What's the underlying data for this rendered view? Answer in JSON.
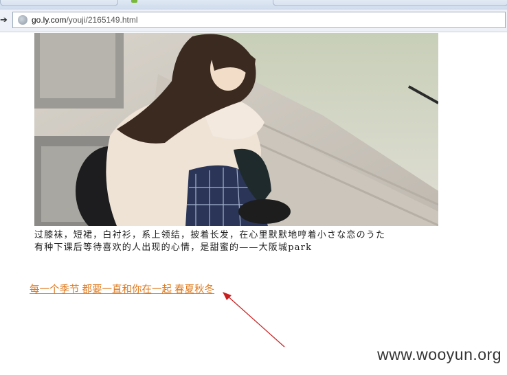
{
  "browser": {
    "url_host": "go.ly.com",
    "url_path": "/youji/2165149.html",
    "back_icon": "back-arrow-icon",
    "site_icon": "globe-icon"
  },
  "article": {
    "photo": "photo of a girl sitting on stone steps hugging her knees",
    "caption_line1": "过膝袜，短裙，白衬衫，系上领结，披着长发，在心里默默地哼着小さな恋のうた",
    "caption_line2": "有种下课后等待喜欢的人出现的心情，是甜蜜的——大阪城park",
    "link_text": "每一个季节 都要一直和你在一起 春夏秋冬"
  },
  "annotation": {
    "arrow_color": "#c81e1e"
  },
  "watermark": "www.wooyun.org",
  "colors": {
    "link": "#e07b1f",
    "arrow": "#c81e1e"
  }
}
